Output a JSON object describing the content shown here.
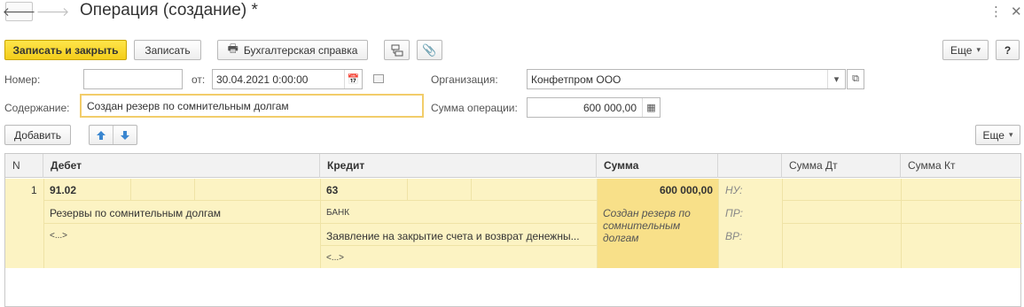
{
  "window": {
    "title": "Операция (создание) *",
    "back_icon": "🡐",
    "forward_icon": "🡒",
    "menu_icon": "⋮",
    "close_icon": "✕"
  },
  "toolbar": {
    "save_close": "Записать и закрыть",
    "save": "Записать",
    "report": "Бухгалтерская справка",
    "more": "Еще",
    "help": "?"
  },
  "form": {
    "number_label": "Номер:",
    "number_value": "",
    "date_label": "от:",
    "date_value": "30.04.2021  0:00:00",
    "org_label": "Организация:",
    "org_value": "Конфетпром ООО",
    "content_label": "Содержание:",
    "content_value": "Создан резерв по сомнительным долгам",
    "sum_label": "Сумма операции:",
    "sum_value": "600 000,00"
  },
  "table_toolbar": {
    "add": "Добавить",
    "more": "Еще"
  },
  "table": {
    "columns": [
      "N",
      "Дебет",
      "Кредит",
      "Сумма",
      "",
      "Сумма Дт",
      "Сумма Кт"
    ],
    "row": {
      "n": "1",
      "debit_account": "91.02",
      "debit_sub1": "Резервы по сомнительным долгам",
      "debit_sub2": "<...>",
      "credit_account": "63",
      "credit_sub1": "БАНК",
      "credit_sub2": "Заявление на закрытие счета и возврат денежны...",
      "credit_sub3": "<...>",
      "amount": "600 000,00",
      "content": "Создан резерв по сомнительным долгам",
      "nu": "НУ:",
      "pr": "ПР:",
      "vr": "ВР:"
    }
  },
  "colors": {
    "accent": "#f3cd1a",
    "row": "#fcf3c3",
    "highlight": "#f8e089"
  }
}
